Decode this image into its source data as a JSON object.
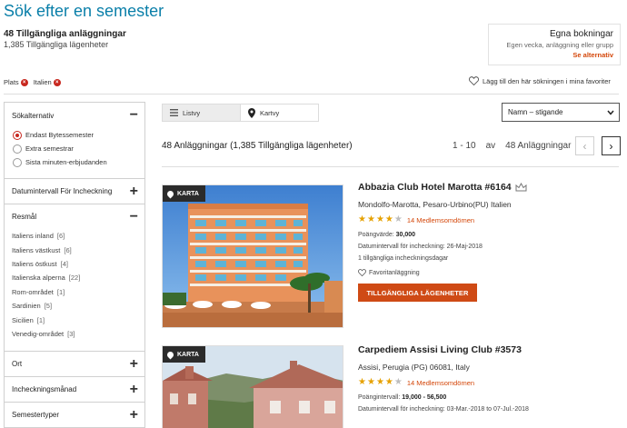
{
  "header": {
    "title": "Sök efter en semester",
    "summary_properties": "48 Tillgängliga anläggningar",
    "summary_units": "1,385 Tillgängliga lägenheter"
  },
  "bookings": {
    "title": "Egna bokningar",
    "subtitle": "Egen vecka, anläggning eller grupp",
    "link": "Se alternativ"
  },
  "filters": {
    "chips": [
      {
        "label": "Plats"
      },
      {
        "label": "Italien"
      }
    ],
    "save_search": "Lägg till den här sökningen i mina favoriter"
  },
  "sidebar": {
    "search_options": {
      "title": "Sökalternativ",
      "options": [
        {
          "label": "Endast Bytessemester",
          "checked": true
        },
        {
          "label": "Extra semestrar",
          "checked": false
        },
        {
          "label": "Sista minuten-erbjudanden",
          "checked": false
        }
      ]
    },
    "checkin_range": "Datumintervall För Incheckning",
    "destination": {
      "title": "Resmål",
      "regions": [
        {
          "name": "Italiens inland",
          "count": "[6]"
        },
        {
          "name": "Italiens västkust",
          "count": "[6]"
        },
        {
          "name": "Italiens östkust",
          "count": "[4]"
        },
        {
          "name": "Italienska alperna",
          "count": "[22]"
        },
        {
          "name": "Rom-området",
          "count": "[1]"
        },
        {
          "name": "Sardinien",
          "count": "[5]"
        },
        {
          "name": "Sicilien",
          "count": "[1]"
        },
        {
          "name": "Venedig-området",
          "count": "[3]"
        }
      ]
    },
    "place": "Ort",
    "checkin_month": "Incheckningsmånad",
    "vacation_types": "Semestertyper"
  },
  "toolbar": {
    "list_view": "Listvy",
    "map_view": "Kartvy",
    "sort_value": "Namn – stigande"
  },
  "results": {
    "count_text": "48 Anläggningar (1,385 Tillgängliga lägenheter)",
    "range": "1 - 10",
    "of": "av",
    "total": "48 Anläggningar"
  },
  "cards": [
    {
      "map_label": "KARTA",
      "name": "Abbazia Club Hotel Marotta #6164",
      "location": "Mondolfo-Marotta,  Pesaro-Urbino(PU)  Italien",
      "rating": 4,
      "reviews": "14 Medlemsomdömen",
      "points_label": "Poängvärde:",
      "points_value": "30,000",
      "checkin": "Datumintervall för incheckning: 26-Maj-2018",
      "days": "1 tillgängliga incheckningsdagar",
      "favorite": "Favoritanläggning",
      "button": "TILLGÄNGLIGA LÄGENHETER"
    },
    {
      "map_label": "KARTA",
      "name": "Carpediem Assisi Living Club #3573",
      "location": "Assisi,  Perugia (PG)  06081,  Italy",
      "rating": 4,
      "reviews": "14 Medlemsomdömen",
      "points_label": "Poängintervall:",
      "points_value": "19,000 - 56,500",
      "checkin": "Datumintervall för incheckning: 03-Mar.-2018 to 07-Jul.-2018"
    }
  ],
  "colors": {
    "title_blue": "#0a7fa9",
    "accent_orange": "#cf4a15",
    "star_gold": "#e6a100",
    "chip_red": "#c7271e"
  }
}
